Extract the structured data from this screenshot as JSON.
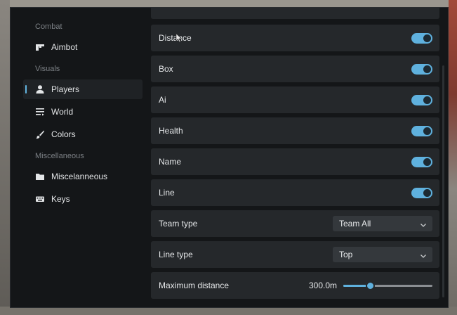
{
  "sidebar": {
    "sections": [
      {
        "label": "Combat"
      },
      {
        "label": "Visuals"
      },
      {
        "label": "Miscellaneous"
      }
    ],
    "items": [
      {
        "label": "Aimbot",
        "icon": "gun-icon",
        "active": false
      },
      {
        "label": "Players",
        "icon": "person-icon",
        "active": true
      },
      {
        "label": "World",
        "icon": "list-icon",
        "active": false
      },
      {
        "label": "Colors",
        "icon": "brush-icon",
        "active": false
      },
      {
        "label": "Miscelanneous",
        "icon": "folder-icon",
        "active": false
      },
      {
        "label": "Keys",
        "icon": "keyboard-icon",
        "active": false
      }
    ]
  },
  "settings": {
    "distance": {
      "label": "Distance",
      "enabled": true
    },
    "box": {
      "label": "Box",
      "enabled": true
    },
    "ai": {
      "label": "Ai",
      "enabled": true
    },
    "health": {
      "label": "Health",
      "enabled": true
    },
    "name": {
      "label": "Name",
      "enabled": true
    },
    "line": {
      "label": "Line",
      "enabled": true
    },
    "team_type": {
      "label": "Team type",
      "value": "Team All"
    },
    "line_type": {
      "label": "Line type",
      "value": "Top"
    },
    "max_distance": {
      "label": "Maximum distance",
      "value_text": "300.0m",
      "fraction": 0.3
    }
  },
  "colors": {
    "accent": "#5fb1de",
    "panel": "#25282b",
    "background": "#141618"
  }
}
